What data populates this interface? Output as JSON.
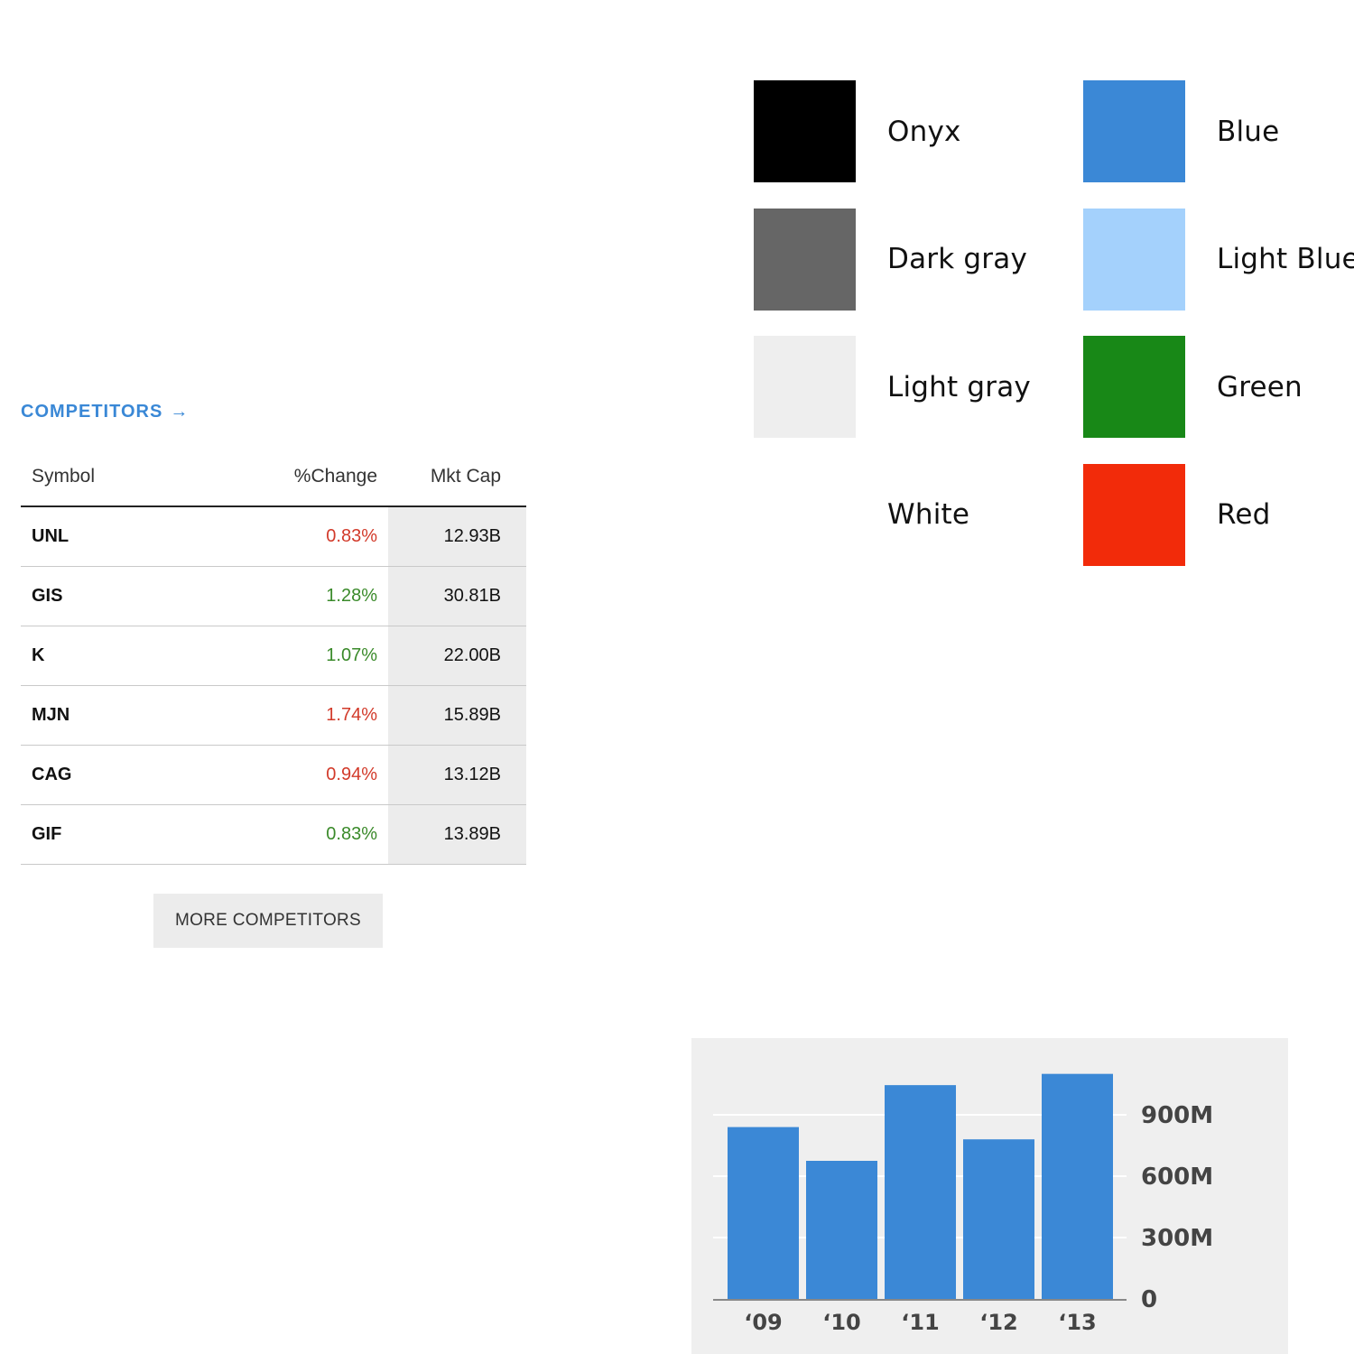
{
  "palette": {
    "swatches": [
      {
        "name": "Onyx",
        "color": "#000000"
      },
      {
        "name": "Dark gray",
        "color": "#666666"
      },
      {
        "name": "Light gray",
        "color": "#eeeeee"
      },
      {
        "name": "White",
        "color": "#ffffff"
      },
      {
        "name": "Blue",
        "color": "#3b88d6"
      },
      {
        "name": "Light Blue",
        "color": "#a4d1fc"
      },
      {
        "name": "Green",
        "color": "#188817"
      },
      {
        "name": "Red",
        "color": "#f22b0a"
      }
    ]
  },
  "competitors": {
    "link_label": "COMPETITORS",
    "link_arrow": "→",
    "headers": {
      "symbol": "Symbol",
      "change": "%Change",
      "mkt_cap": "Mkt Cap"
    },
    "rows": [
      {
        "symbol": "UNL",
        "change": "0.83%",
        "direction": "negative",
        "mkt_cap": "12.93B"
      },
      {
        "symbol": "GIS",
        "change": "1.28%",
        "direction": "positive",
        "mkt_cap": "30.81B"
      },
      {
        "symbol": "K",
        "change": "1.07%",
        "direction": "positive",
        "mkt_cap": "22.00B"
      },
      {
        "symbol": "MJN",
        "change": "1.74%",
        "direction": "negative",
        "mkt_cap": "15.89B"
      },
      {
        "symbol": "CAG",
        "change": "0.94%",
        "direction": "negative",
        "mkt_cap": "13.12B"
      },
      {
        "symbol": "GIF",
        "change": "0.83%",
        "direction": "positive",
        "mkt_cap": "13.89B"
      }
    ],
    "more_button": "MORE COMPETITORS",
    "colors": {
      "link": "#3a88d6",
      "negative": "#d23a2a",
      "positive": "#3a8a2a",
      "cap_bg": "#ececec"
    }
  },
  "chart_data": {
    "type": "bar",
    "categories": [
      "‘09",
      "‘10",
      "‘11",
      "‘12",
      "‘13"
    ],
    "values": [
      840,
      675,
      1045,
      780,
      1100
    ],
    "y_ticks": [
      {
        "value": 0,
        "label": "0"
      },
      {
        "value": 300,
        "label": "300M"
      },
      {
        "value": 600,
        "label": "600M"
      },
      {
        "value": 900,
        "label": "900M"
      }
    ],
    "ylim": [
      0,
      1150
    ],
    "grid": true,
    "y_axis_side": "right",
    "bar_color": "#3b88d6",
    "panel_bg": "#efefef"
  }
}
